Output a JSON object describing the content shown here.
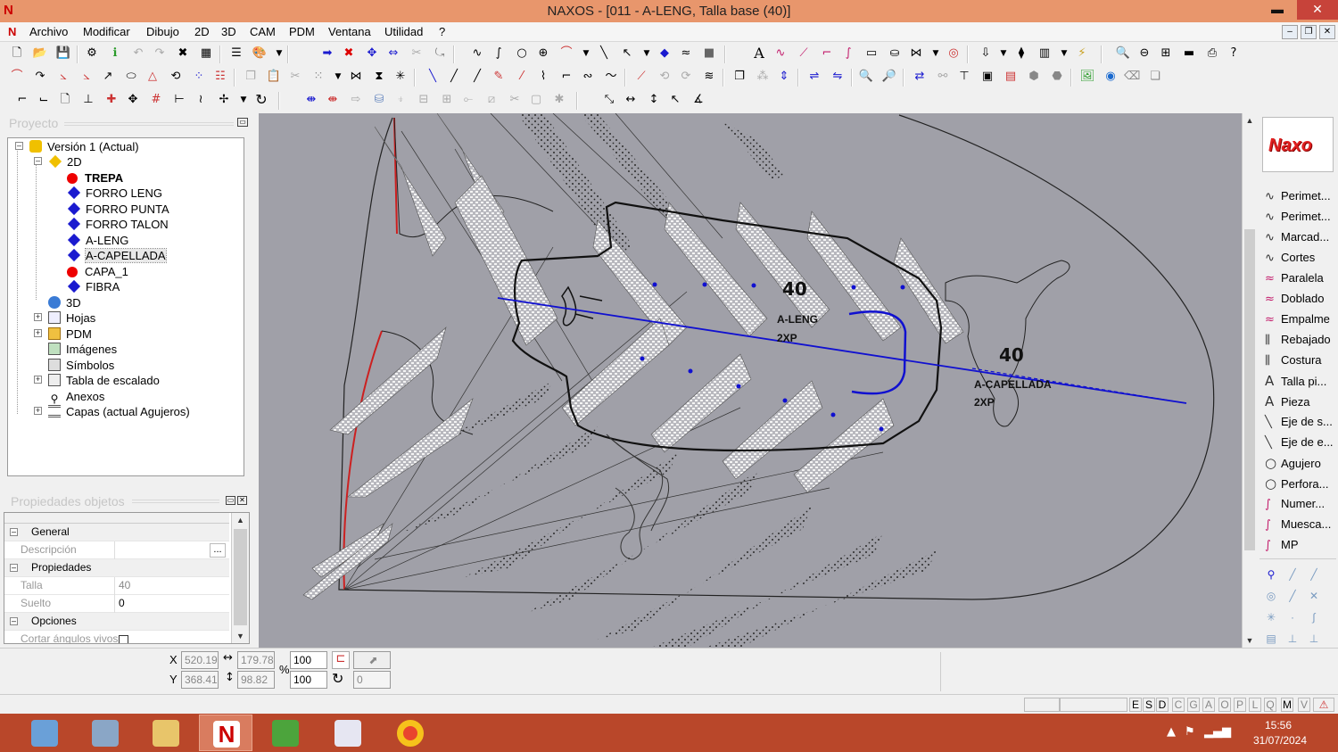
{
  "window": {
    "title": "NAXOS - [011 - A-LENG, Talla base (40)]",
    "controls": {
      "minimize": "▬",
      "restore": "❐",
      "close": "✕"
    }
  },
  "menu": {
    "items": [
      "Archivo",
      "Modificar",
      "Dibujo",
      "2D",
      "3D",
      "CAM",
      "PDM",
      "Ventana",
      "Utilidad",
      "?"
    ],
    "mdi_controls": [
      "–",
      "❐",
      "✕"
    ]
  },
  "project_panel": {
    "title": "Proyecto",
    "tree": [
      {
        "label": "Versión 1 (Actual)",
        "icon": "version-icon"
      },
      {
        "label": "2D",
        "icon": "layer-2d-icon"
      },
      {
        "label": "TREPA",
        "icon": "red-dot-icon",
        "bold": true
      },
      {
        "label": "FORRO LENG",
        "icon": "blue-diamond-icon"
      },
      {
        "label": "FORRO PUNTA",
        "icon": "blue-diamond-icon"
      },
      {
        "label": "FORRO TALON",
        "icon": "blue-diamond-icon"
      },
      {
        "label": "A-LENG",
        "icon": "blue-diamond-icon"
      },
      {
        "label": "A-CAPELLADA",
        "icon": "blue-diamond-icon",
        "selected": true
      },
      {
        "label": "CAPA_1",
        "icon": "red-dot-icon"
      },
      {
        "label": "FIBRA",
        "icon": "blue-diamond-icon"
      },
      {
        "label": "3D",
        "icon": "layer-3d-icon"
      },
      {
        "label": "Hojas",
        "icon": "sheets-icon"
      },
      {
        "label": "PDM",
        "icon": "folder-icon"
      },
      {
        "label": "Imágenes",
        "icon": "image-icon"
      },
      {
        "label": "Símbolos",
        "icon": "symbol-icon"
      },
      {
        "label": "Tabla de escalado",
        "icon": "table-icon"
      },
      {
        "label": "Anexos",
        "icon": "attachment-icon"
      },
      {
        "label": "Capas (actual Agujeros)",
        "icon": "layers-icon"
      }
    ]
  },
  "properties_panel": {
    "title": "Propiedades objetos",
    "rows": [
      {
        "type": "category",
        "label": "General"
      },
      {
        "type": "prop",
        "label": "Descripción",
        "value": "",
        "button": "..."
      },
      {
        "type": "category",
        "label": "Propiedades"
      },
      {
        "type": "prop",
        "label": "Talla",
        "value": "40"
      },
      {
        "type": "prop",
        "label": "Suelto",
        "value": "0"
      },
      {
        "type": "category",
        "label": "Opciones"
      },
      {
        "type": "prop",
        "label": "Cortar ángulos vivos",
        "value": ""
      }
    ]
  },
  "canvas": {
    "labels": [
      {
        "size": "40",
        "piece": "A-LENG",
        "qty": "2XP"
      },
      {
        "size": "40",
        "piece": "A-CAPELLADA",
        "qty": "2XP"
      }
    ],
    "colors": {
      "background": "#a0a0a8",
      "outline": "#111111",
      "axis": "#1010d0",
      "edge": "#cc2020"
    }
  },
  "right_panel": {
    "logo": "Naxo",
    "tools": [
      {
        "label": "Perimet...",
        "icon": "curve-icon"
      },
      {
        "label": "Perimet...",
        "icon": "curve-icon"
      },
      {
        "label": "Marcad...",
        "icon": "curve-icon"
      },
      {
        "label": "Cortes",
        "icon": "curve-icon"
      },
      {
        "label": "Paralela",
        "icon": "parallel-icon"
      },
      {
        "label": "Doblado",
        "icon": "fold-icon"
      },
      {
        "label": "Empalme",
        "icon": "join-icon"
      },
      {
        "label": "Rebajado",
        "icon": "skive-icon"
      },
      {
        "label": "Costura",
        "icon": "stitch-icon"
      },
      {
        "label": "Talla pi...",
        "icon": "text-icon"
      },
      {
        "label": "Pieza",
        "icon": "text-icon"
      },
      {
        "label": "Eje de s...",
        "icon": "axis-icon"
      },
      {
        "label": "Eje de e...",
        "icon": "axis-icon"
      },
      {
        "label": "Agujero",
        "icon": "circle-icon"
      },
      {
        "label": "Perfora...",
        "icon": "circle-icon"
      },
      {
        "label": "Numer...",
        "icon": "pen-icon"
      },
      {
        "label": "Muesca...",
        "icon": "pen-icon"
      },
      {
        "label": "MP",
        "icon": "pen-icon"
      }
    ]
  },
  "coords": {
    "x_label": "X",
    "y_label": "Y",
    "x": "520.19",
    "y": "368.41",
    "width": "179.78",
    "height": "98.82",
    "scale_x": "100",
    "scale_y": "100",
    "percent": "%",
    "rotation": "0"
  },
  "status": {
    "flags": [
      "E",
      "S",
      "D",
      "C",
      "G",
      "A",
      "O",
      "P",
      "L",
      "Q",
      "M",
      "V"
    ],
    "active_flags": [
      "E",
      "S",
      "D",
      "M",
      "V"
    ]
  },
  "taskbar": {
    "apps": [
      "calculator-app",
      "explorer-app",
      "files-app",
      "naxos-app",
      "leaf-app",
      "info-app",
      "chrome-app"
    ],
    "time": "15:56",
    "date": "31/07/2024"
  }
}
